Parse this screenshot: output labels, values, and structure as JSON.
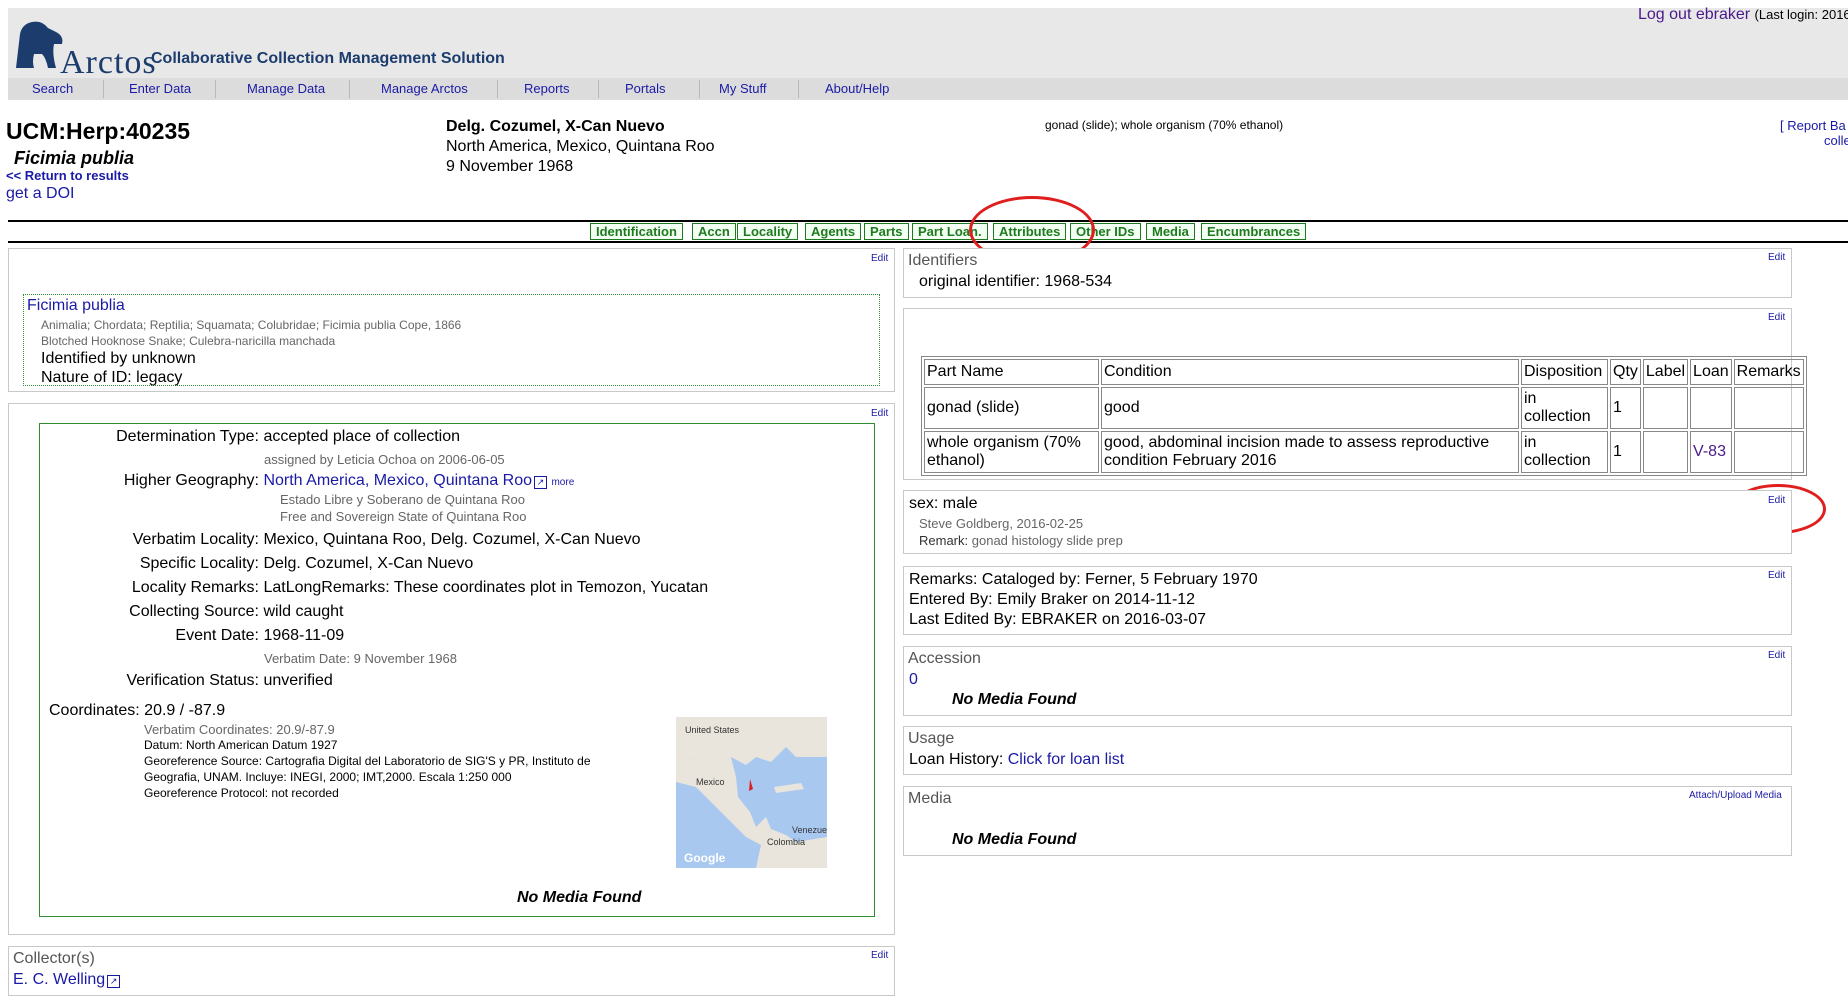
{
  "header": {
    "logo_text": "Arctos",
    "tagline": "Collaborative Collection Management Solution",
    "logout_label": "Log out ebraker",
    "last_login": "(Last login: 2016"
  },
  "menu": [
    "Search",
    "Enter Data",
    "Manage Data",
    "Manage Arctos",
    "Reports",
    "Portals",
    "My Stuff",
    "About/Help"
  ],
  "record": {
    "catalog_number": "UCM:Herp:40235",
    "scientific_name": "Ficimia publia",
    "return_link": "<< Return to results",
    "doi_link": "get a DOI",
    "locality_title": "Delg. Cozumel, X-Can Nuevo",
    "higher_geo": "North America, Mexico, Quintana Roo",
    "date": "9 November 1968",
    "parts_summary": "gonad (slide); whole organism (70% ethanol)",
    "report_link": "[ Report Ba",
    "report_link2": "colle"
  },
  "tabs": [
    "Identification",
    "Accn",
    "Locality",
    "Agents",
    "Parts",
    "Part Loan.",
    "Attributes",
    "Other IDs",
    "Media",
    "Encumbrances"
  ],
  "edit_label": "Edit",
  "identification": {
    "name": "Ficimia publia",
    "taxonomy": "Animalia; Chordata; Reptilia; Squamata; Colubridae; Ficimia publia Cope, 1866",
    "common_names": "Blotched Hooknose Snake; Culebra-naricilla manchada",
    "identified_by": "Identified by unknown",
    "nature_of_id": "Nature of ID: legacy"
  },
  "locality": {
    "determination_type_label": "Determination Type:",
    "determination_type": "accepted place of collection",
    "assigned_by": "assigned by Leticia Ochoa on 2006-06-05",
    "higher_geography_label": "Higher Geography:",
    "higher_geography": "North America, Mexico, Quintana Roo",
    "more": "more",
    "alt_name1": "Estado Libre y Soberano de Quintana Roo",
    "alt_name2": "Free and Sovereign State of Quintana Roo",
    "verbatim_locality_label": "Verbatim Locality:",
    "verbatim_locality": "Mexico, Quintana Roo, Delg. Cozumel, X-Can Nuevo",
    "specific_locality_label": "Specific Locality:",
    "specific_locality": "Delg. Cozumel, X-Can Nuevo",
    "locality_remarks_label": "Locality Remarks:",
    "locality_remarks": "LatLongRemarks: These coordinates plot in Temozon, Yucatan",
    "collecting_source_label": "Collecting Source:",
    "collecting_source": "wild caught",
    "event_date_label": "Event Date:",
    "event_date": "1968-11-09",
    "verbatim_date": "Verbatim Date: 9 November 1968",
    "verification_status_label": "Verification Status:",
    "verification_status": "unverified",
    "coordinates": "Coordinates: 20.9 / -87.9",
    "verbatim_coordinates": "Verbatim Coordinates: 20.9/-87.9",
    "datum": "Datum: North American Datum 1927",
    "georef_source_line1": "Georeference Source: Cartografia Digital del Laboratorio de SIG'S y PR, Instituto de",
    "georef_source_line2": "Geografia, UNAM. Incluye: INEGI, 2000; IMT,2000. Escala 1:250 000",
    "georef_protocol": "Georeference Protocol: not recorded",
    "map_labels": {
      "us": "United States",
      "mexico": "Mexico",
      "venezuela": "Venezue",
      "colombia": "Colombia",
      "google": "Google"
    },
    "no_media": "No Media Found"
  },
  "collectors": {
    "title": "Collector(s)",
    "name": "E. C. Welling"
  },
  "identifiers": {
    "title": "Identifiers",
    "value": "original identifier: 1968-534"
  },
  "parts": {
    "headers": [
      "Part Name",
      "Condition",
      "Disposition",
      "Qty",
      "Label",
      "Loan",
      "Remarks"
    ],
    "rows": [
      {
        "part_name": "gonad (slide)",
        "condition": "good",
        "disposition": "in collection",
        "qty": "1",
        "label": "",
        "loan": "",
        "remarks": ""
      },
      {
        "part_name": "whole organism (70% ethanol)",
        "condition": "good, abdominal incision made to assess reproductive condition February 2016",
        "disposition": "in collection",
        "qty": "1",
        "label": "",
        "loan": "V-83",
        "remarks": ""
      }
    ]
  },
  "attributes": {
    "sex": "sex: male",
    "determiner": "Steve Goldberg, 2016-02-25",
    "remark_label": "Remark:",
    "remark": "gonad histology slide prep"
  },
  "remarks": {
    "cataloged": "Remarks: Cataloged by: Ferner, 5 February 1970",
    "entered": "Entered By: Emily Braker on 2014-11-12",
    "edited": "Last Edited By: EBRAKER on 2016-03-07"
  },
  "accession": {
    "title": "Accession",
    "value": "0",
    "no_media": "No Media Found"
  },
  "usage": {
    "title": "Usage",
    "loan_history_label": "Loan History:",
    "loan_link": "Click for loan list"
  },
  "media": {
    "title": "Media",
    "attach_link": "Attach/Upload Media",
    "no_media": "No Media Found"
  },
  "colors": {
    "link": "#1a1aa6",
    "tab_green": "#1e7a1e",
    "annotation_red": "#e01e1e",
    "brand_navy": "#1d3c6e"
  }
}
